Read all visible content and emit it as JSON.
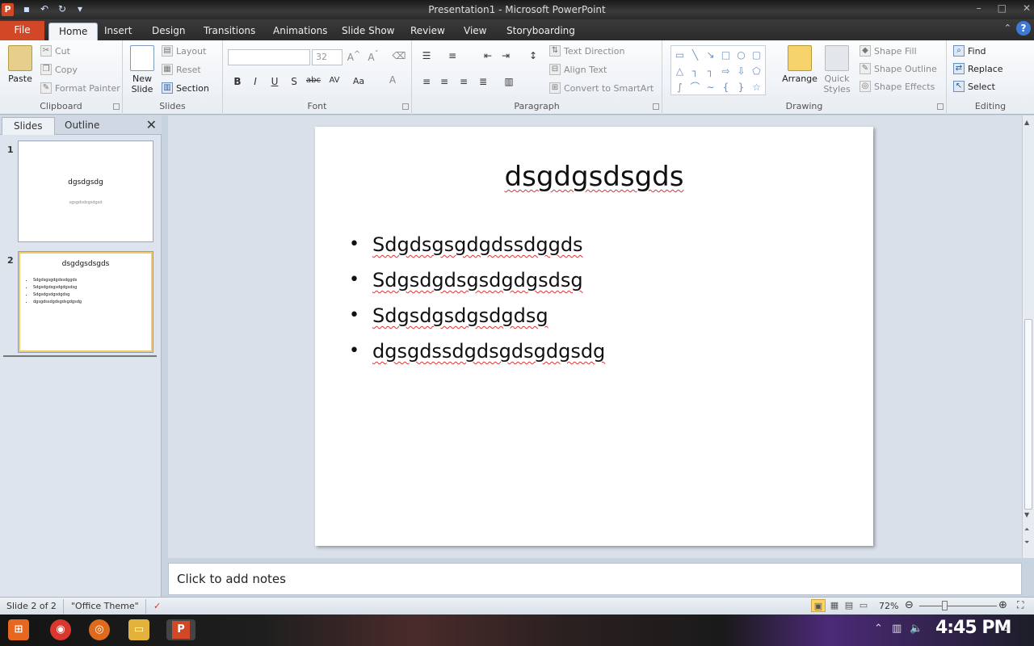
{
  "window": {
    "title": "Presentation1 - Microsoft PowerPoint",
    "controls": [
      "–",
      "□",
      "✕"
    ]
  },
  "tabs": [
    "File",
    "Home",
    "Insert",
    "Design",
    "Transitions",
    "Animations",
    "Slide Show",
    "Review",
    "View",
    "Storyboarding"
  ],
  "ribbon": {
    "clipboard": {
      "label": "Clipboard",
      "paste": "Paste",
      "cut": "Cut",
      "copy": "Copy",
      "format_painter": "Format Painter"
    },
    "slides": {
      "label": "Slides",
      "new_slide_line1": "New",
      "new_slide_line2": "Slide",
      "layout": "Layout",
      "reset": "Reset",
      "section": "Section"
    },
    "font": {
      "label": "Font",
      "font_size": "32"
    },
    "paragraph": {
      "label": "Paragraph",
      "text_direction": "Text Direction",
      "align_text": "Align Text",
      "convert_smartart": "Convert to SmartArt"
    },
    "drawing": {
      "label": "Drawing",
      "arrange": "Arrange",
      "quick_styles_line1": "Quick",
      "quick_styles_line2": "Styles",
      "shape_fill": "Shape Fill",
      "shape_outline": "Shape Outline",
      "shape_effects": "Shape Effects"
    },
    "editing": {
      "label": "Editing",
      "find": "Find",
      "replace": "Replace",
      "select": "Select"
    }
  },
  "left_pane": {
    "tab_slides": "Slides",
    "tab_outline": "Outline",
    "thumbnails": [
      {
        "number": "1",
        "title": "dgsdgsdg",
        "subtitle": "sgsgdsdsgsdgsd"
      },
      {
        "number": "2",
        "title": "dsgdgsdsgds",
        "bullets": [
          "Sdgdsgsgdgdssdggds",
          "Sdgsdgdsgsdgdgsdsg",
          "Sdgsdgsdgsdgdsg",
          "dgsgdssdgdsgdsgdgsdg"
        ]
      }
    ]
  },
  "slide": {
    "title": "dsgdgsdsgds",
    "bullets": [
      "Sdgdsgsgdgdssdggds",
      "Sdgsdgdsgsdgdgsdsg",
      "Sdgsdgsdgsdgdsg",
      "dgsgdssdgdsgdsgdgsdg"
    ]
  },
  "notes": {
    "placeholder": "Click to add notes"
  },
  "status": {
    "slide_info": "Slide 2 of 2",
    "theme": "\"Office Theme\"",
    "zoom": "72%"
  },
  "taskbar": {
    "time": "4:45 PM"
  },
  "colors": {
    "file_tab": "#d24726",
    "accent": "#3d7ad8",
    "active_view": "#fbd46a"
  }
}
